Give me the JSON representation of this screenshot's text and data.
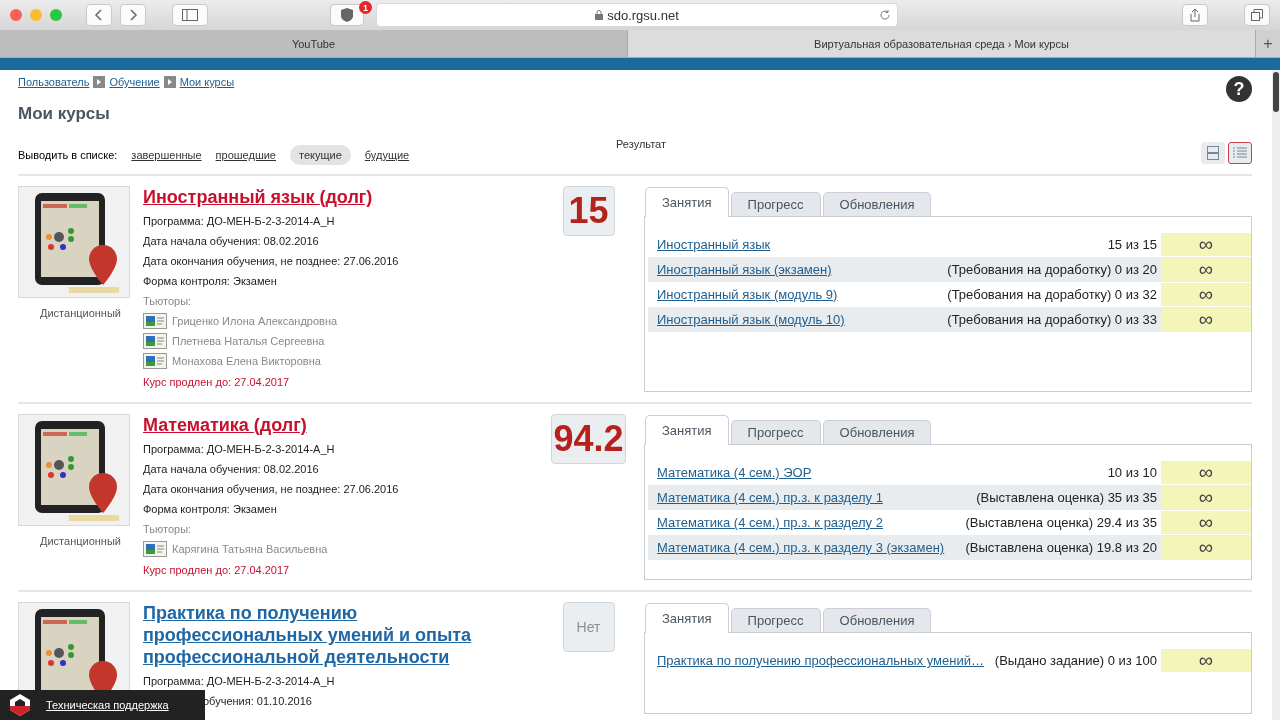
{
  "browser": {
    "url": "sdo.rgsu.net",
    "badge": "1",
    "new_tab": "+",
    "tabs": [
      {
        "title": "YouTube",
        "selected": false
      },
      {
        "title": "Виртуальная образовательная среда › Мои курсы",
        "selected": true
      }
    ]
  },
  "breadcrumbs": [
    "Пользователь",
    "Обучение",
    "Мои курсы"
  ],
  "help": "?",
  "heading": "Мои курсы",
  "filter": {
    "label": "Выводить в списке:",
    "options": [
      {
        "label": "завершенные",
        "selected": false
      },
      {
        "label": "прошедшие",
        "selected": false
      },
      {
        "label": "текущие",
        "selected": true
      },
      {
        "label": "будущие",
        "selected": false
      }
    ]
  },
  "result_label": "Результат",
  "view_toggle": [
    {
      "kind": "rows",
      "selected": false
    },
    {
      "kind": "list",
      "selected": true
    }
  ],
  "courses": [
    {
      "title": "Иностранный язык (долг)",
      "debt": true,
      "score": "15",
      "score_empty": false,
      "mode": "Дистанционный",
      "details": [
        "Программа: ДО-МЕН-Б-2-3-2014-А_Н",
        "Дата начала обучения: 08.02.2016",
        "Дата окончания обучения, не позднее: 27.06.2016",
        "Форма контроля: Экзамен"
      ],
      "tutors_label": "Тьюторы:",
      "tutors": [
        "Гриценко Илона Александровна",
        "Плетнева Наталья Сергеевна",
        "Монахова Елена Викторовна"
      ],
      "extension": "Курс продлен до: 27.04.2017",
      "tabs": [
        {
          "label": "Занятия",
          "selected": true
        },
        {
          "label": "Прогресс",
          "selected": false
        },
        {
          "label": "Обновления",
          "selected": false
        }
      ],
      "lessons": [
        {
          "title": "Иностранный язык",
          "status": "15 из 15",
          "mark": "∞"
        },
        {
          "title": "Иностранный язык (экзамен)",
          "status": "(Требования на доработку) 0 из 20",
          "mark": "∞"
        },
        {
          "title": "Иностранный язык (модуль 9)",
          "status": "(Требования на доработку) 0 из 32",
          "mark": "∞"
        },
        {
          "title": "Иностранный язык (модуль 10)",
          "status": "(Требования на доработку) 0 из 33",
          "mark": "∞"
        }
      ]
    },
    {
      "title": "Математика (долг)",
      "debt": true,
      "score": "94.2",
      "score_empty": false,
      "mode": "Дистанционный",
      "details": [
        "Программа: ДО-МЕН-Б-2-3-2014-А_Н",
        "Дата начала обучения: 08.02.2016",
        "Дата окончания обучения, не позднее: 27.06.2016",
        "Форма контроля: Экзамен"
      ],
      "tutors_label": "Тьюторы:",
      "tutors": [
        "Карягина Татьяна Васильевна"
      ],
      "extension": "Курс продлен до: 27.04.2017",
      "tabs": [
        {
          "label": "Занятия",
          "selected": true
        },
        {
          "label": "Прогресс",
          "selected": false
        },
        {
          "label": "Обновления",
          "selected": false
        }
      ],
      "lessons": [
        {
          "title": "Математика (4 сем.) ЭОР",
          "status": "10 из 10",
          "mark": "∞"
        },
        {
          "title": "Математика (4 сем.) пр.з. к разделу 1",
          "status": "(Выставлена оценка) 35 из 35",
          "mark": "∞"
        },
        {
          "title": "Математика (4 сем.) пр.з. к разделу 2",
          "status": "(Выставлена оценка) 29.4 из 35",
          "mark": "∞"
        },
        {
          "title": "Математика (4 сем.) пр.з. к разделу 3 (экзамен)",
          "status": "(Выставлена оценка) 19.8 из 20",
          "mark": "∞"
        }
      ]
    },
    {
      "title": "Практика по получению профессиональных умений и опыта профессиональной деятельности",
      "debt": false,
      "score": "Нет",
      "score_empty": true,
      "details": [
        "Программа: ДО-МЕН-Б-2-3-2014-А_Н"
      ],
      "partial_detail": "обучения: 01.10.2016",
      "tabs": [
        {
          "label": "Занятия",
          "selected": true
        },
        {
          "label": "Прогресс",
          "selected": false
        },
        {
          "label": "Обновления",
          "selected": false
        }
      ],
      "lessons": [
        {
          "title": "Практика по получению профессиональных умений…",
          "status": "(Выдано задание) 0 из 100",
          "mark": "∞"
        }
      ]
    }
  ],
  "support": {
    "label": "Техническая поддержка"
  }
}
